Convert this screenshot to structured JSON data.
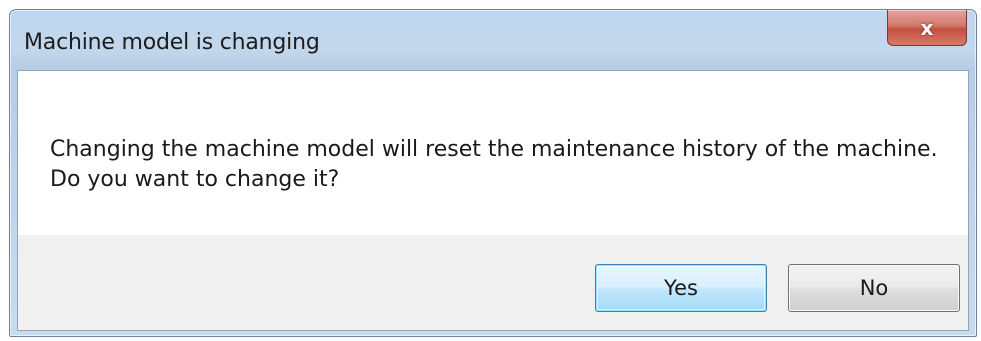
{
  "dialog": {
    "title": "Machine model is changing",
    "close_glyph": "x",
    "close_icon": "close-icon",
    "message_line1": "Changing the machine model will reset the maintenance history of the machine.",
    "message_line2": "Do you want to change it?",
    "buttons": {
      "yes_label": "Yes",
      "no_label": "No"
    }
  }
}
